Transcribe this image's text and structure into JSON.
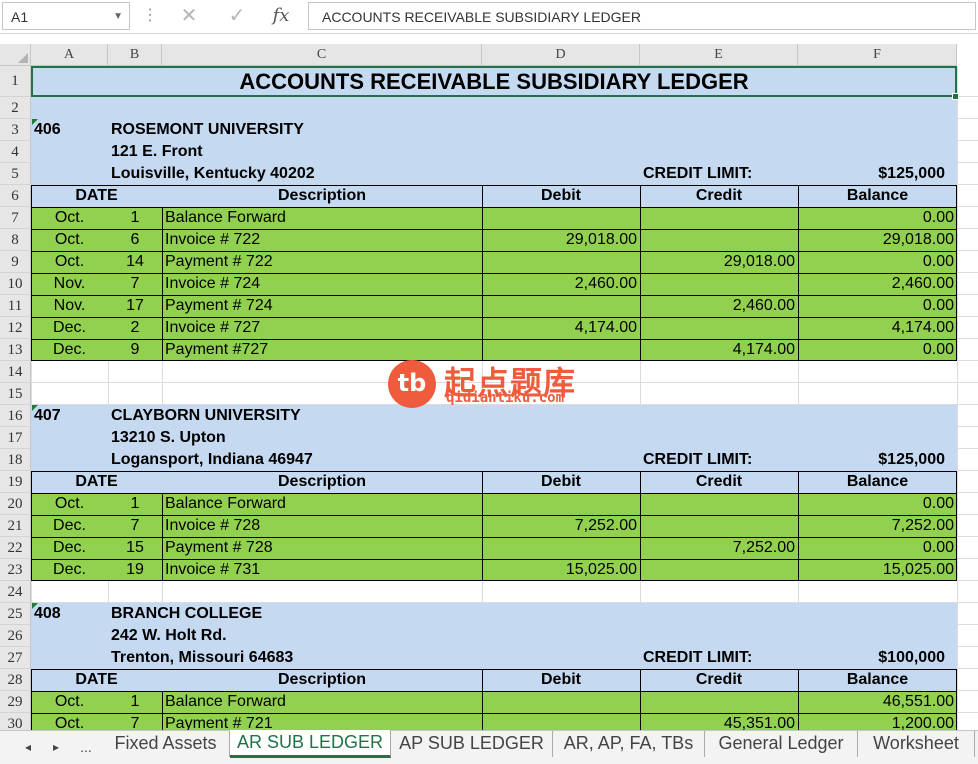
{
  "formula_bar": {
    "name_box": "A1",
    "cancel_icon": "✕",
    "enter_icon": "✓",
    "fx_label": "fx",
    "formula": "ACCOUNTS RECEIVABLE SUBSIDIARY LEDGER"
  },
  "columns": [
    "A",
    "B",
    "C",
    "D",
    "E",
    "F"
  ],
  "rows": [
    "1",
    "2",
    "3",
    "4",
    "5",
    "6",
    "7",
    "8",
    "9",
    "10",
    "11",
    "12",
    "13",
    "14",
    "15",
    "16",
    "17",
    "18",
    "19",
    "20",
    "21",
    "22",
    "23",
    "24",
    "25",
    "26",
    "27",
    "28",
    "29",
    "30"
  ],
  "sheet": {
    "title": "ACCOUNTS RECEIVABLE SUBSIDIARY LEDGER",
    "table_headers": {
      "date": "DATE",
      "description": "Description",
      "debit": "Debit",
      "credit": "Credit",
      "balance": "Balance"
    },
    "credit_limit_label": "CREDIT LIMIT:",
    "customers": [
      {
        "number": "406",
        "name": "ROSEMONT UNIVERSITY",
        "address": "121 E. Front",
        "city": "Louisville, Kentucky 40202",
        "credit_limit": "$125,000",
        "entries": [
          {
            "month": "Oct.",
            "day": "1",
            "description": "Balance Forward",
            "debit": "",
            "credit": "",
            "balance": "0.00"
          },
          {
            "month": "Oct.",
            "day": "6",
            "description": "Invoice # 722",
            "debit": "29,018.00",
            "credit": "",
            "balance": "29,018.00"
          },
          {
            "month": "Oct.",
            "day": "14",
            "description": "Payment # 722",
            "debit": "",
            "credit": "29,018.00",
            "balance": "0.00"
          },
          {
            "month": "Nov.",
            "day": "7",
            "description": "Invoice # 724",
            "debit": "2,460.00",
            "credit": "",
            "balance": "2,460.00"
          },
          {
            "month": "Nov.",
            "day": "17",
            "description": "Payment # 724",
            "debit": "",
            "credit": "2,460.00",
            "balance": "0.00"
          },
          {
            "month": "Dec.",
            "day": "2",
            "description": "Invoice # 727",
            "debit": "4,174.00",
            "credit": "",
            "balance": "4,174.00"
          },
          {
            "month": "Dec.",
            "day": "9",
            "description": "Payment #727",
            "debit": "",
            "credit": "4,174.00",
            "balance": "0.00"
          }
        ]
      },
      {
        "number": "407",
        "name": "CLAYBORN UNIVERSITY",
        "address": "13210 S. Upton",
        "city": "Logansport, Indiana 46947",
        "credit_limit": "$125,000",
        "entries": [
          {
            "month": "Oct.",
            "day": "1",
            "description": "Balance Forward",
            "debit": "",
            "credit": "",
            "balance": "0.00"
          },
          {
            "month": "Dec.",
            "day": "7",
            "description": "Invoice # 728",
            "debit": "7,252.00",
            "credit": "",
            "balance": "7,252.00"
          },
          {
            "month": "Dec.",
            "day": "15",
            "description": "Payment # 728",
            "debit": "",
            "credit": "7,252.00",
            "balance": "0.00"
          },
          {
            "month": "Dec.",
            "day": "19",
            "description": "Invoice # 731",
            "debit": "15,025.00",
            "credit": "",
            "balance": "15,025.00"
          }
        ]
      },
      {
        "number": "408",
        "name": "BRANCH COLLEGE",
        "address": "242 W. Holt Rd.",
        "city": "Trenton, Missouri 64683",
        "credit_limit": "$100,000",
        "entries": [
          {
            "month": "Oct.",
            "day": "1",
            "description": "Balance Forward",
            "debit": "",
            "credit": "",
            "balance": "46,551.00"
          },
          {
            "month": "Oct.",
            "day": "7",
            "description": "Payment # 721",
            "debit": "",
            "credit": "45,351.00",
            "balance": "1,200.00"
          }
        ]
      }
    ]
  },
  "watermark": {
    "logo": "tb",
    "brand": "起点题库",
    "url": "qidiantiku.com"
  },
  "tabs": {
    "nav_prev": "◂",
    "nav_next": "▸",
    "nav_more": "...",
    "items": [
      "Fixed Assets",
      "AR SUB LEDGER",
      "AP SUB LEDGER",
      "AR, AP, FA, TBs",
      "General Ledger",
      "Worksheet"
    ],
    "active": "AR SUB LEDGER"
  }
}
